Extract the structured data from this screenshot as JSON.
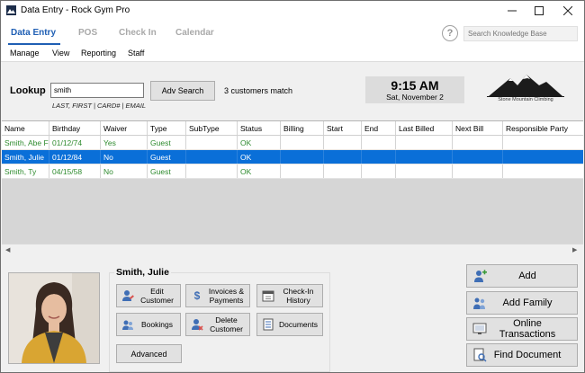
{
  "window": {
    "title": "Data Entry - Rock Gym Pro"
  },
  "tabs": [
    {
      "label": "Data Entry",
      "active": true
    },
    {
      "label": "POS",
      "active": false
    },
    {
      "label": "Check In",
      "active": false
    },
    {
      "label": "Calendar",
      "active": false
    }
  ],
  "help": {
    "icon": "question-circle-icon",
    "glyph": "?"
  },
  "knowledge_search": {
    "placeholder": "Search Knowledge Base",
    "value": ""
  },
  "menu": [
    "Manage",
    "View",
    "Reporting",
    "Staff"
  ],
  "lookup": {
    "label": "Lookup",
    "value": "smith",
    "hint": "LAST, FIRST | CARD# | EMAIL",
    "adv_search_label": "Adv Search",
    "match_text": "3 customers match"
  },
  "clock": {
    "time": "9:15 AM",
    "date": "Sat, November 2"
  },
  "logo": {
    "caption": "Stone Mountain Climbing"
  },
  "table": {
    "columns": [
      "Name",
      "Birthday",
      "Waiver",
      "Type",
      "SubType",
      "Status",
      "Billing",
      "Start",
      "End",
      "Last Billed",
      "Next Bill",
      "Responsible Party"
    ],
    "rows": [
      {
        "cells": [
          "Smith, Abe F",
          "01/12/74",
          "Yes",
          "Guest",
          "",
          "OK",
          "",
          "",
          "",
          "",
          "",
          ""
        ],
        "selected": false
      },
      {
        "cells": [
          "Smith, Julie",
          "01/12/84",
          "No",
          "Guest",
          "",
          "OK",
          "",
          "",
          "",
          "",
          "",
          ""
        ],
        "selected": true
      },
      {
        "cells": [
          "Smith, Ty",
          "04/15/58",
          "No",
          "Guest",
          "",
          "OK",
          "",
          "",
          "",
          "",
          "",
          ""
        ],
        "selected": false
      }
    ]
  },
  "customer": {
    "name": "Smith, Julie",
    "actions": {
      "edit_customer": "Edit\nCustomer",
      "invoices_payments": "Invoices &\nPayments",
      "checkin_history": "Check-In\nHistory",
      "bookings": "Bookings",
      "delete_customer": "Delete\nCustomer",
      "documents": "Documents",
      "advanced": "Advanced"
    }
  },
  "side_buttons": {
    "add": "Add",
    "add_family": "Add Family",
    "online_transactions": "Online Transactions",
    "find_document": "Find Document"
  },
  "colors": {
    "accent": "#1f5fb4",
    "selected_row": "#0a6fd8",
    "active_text": "#2e8b2e"
  }
}
